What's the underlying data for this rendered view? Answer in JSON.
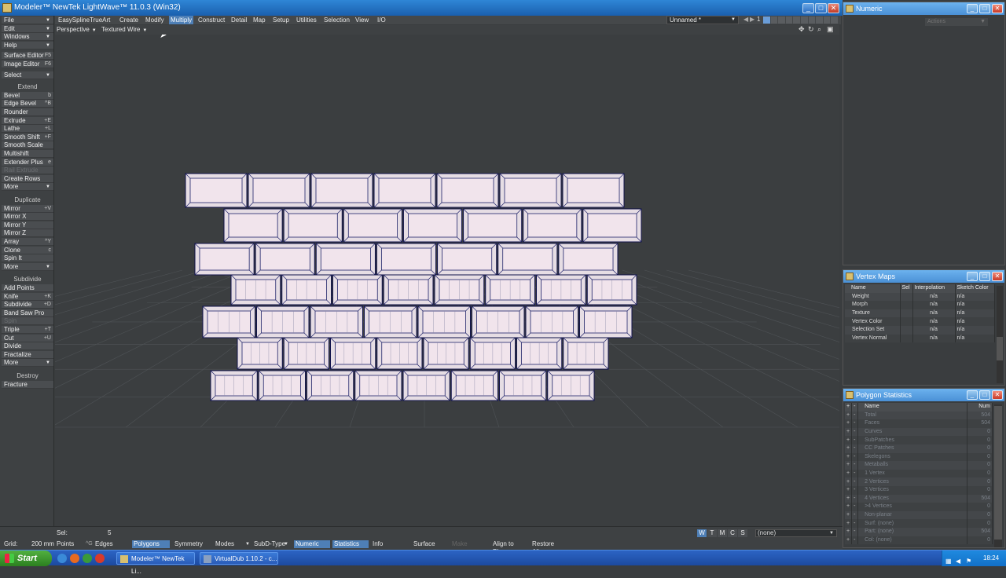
{
  "window": {
    "title": "Modeler™ NewTek LightWave™ 11.0.3 (Win32)"
  },
  "menus": [
    "EasySpline",
    "TrueArt",
    "Create",
    "Modify",
    "Multiply",
    "Construct",
    "Detail",
    "Map",
    "Setup",
    "Utilities",
    "Selection",
    "View",
    "I/O"
  ],
  "active_menu": "Multiply",
  "layer": {
    "object": "Unnamed *",
    "number": "1"
  },
  "viewport": {
    "view": "Perspective",
    "render_mode": "Textured Wire"
  },
  "left_top": [
    {
      "label": "File",
      "sc": "",
      "dd": true
    },
    {
      "label": "Edit",
      "sc": "",
      "dd": true
    },
    {
      "label": "Windows",
      "sc": "",
      "dd": true
    },
    {
      "label": "Help",
      "sc": "",
      "dd": true
    },
    {
      "label": "Surface Editor",
      "sc": "F5",
      "dd": false
    },
    {
      "label": "Image Editor",
      "sc": "F6",
      "dd": false
    },
    {
      "label": "Select",
      "sc": "",
      "dd": true
    }
  ],
  "sections": {
    "extend": {
      "header": "Extend",
      "items": [
        {
          "label": "Bevel",
          "sc": "b"
        },
        {
          "label": "Edge Bevel",
          "sc": "^B"
        },
        {
          "label": "Rounder",
          "sc": ""
        },
        {
          "label": "Extrude",
          "sc": "+E"
        },
        {
          "label": "Lathe",
          "sc": "+L"
        },
        {
          "label": "Smooth Shift",
          "sc": "+F"
        },
        {
          "label": "Smooth Scale",
          "sc": ""
        },
        {
          "label": "Multishift",
          "sc": ""
        },
        {
          "label": "Extender Plus",
          "sc": "e"
        },
        {
          "label": "Rail Extrude",
          "sc": "",
          "dis": true
        },
        {
          "label": "Create Rows",
          "sc": ""
        },
        {
          "label": "More",
          "sc": "",
          "dd": true
        }
      ]
    },
    "duplicate": {
      "header": "Duplicate",
      "items": [
        {
          "label": "Mirror",
          "sc": "+V"
        },
        {
          "label": "Mirror X",
          "sc": ""
        },
        {
          "label": "Mirror Y",
          "sc": ""
        },
        {
          "label": "Mirror Z",
          "sc": ""
        },
        {
          "label": "Array",
          "sc": "^Y"
        },
        {
          "label": "Clone",
          "sc": "c"
        },
        {
          "label": "Spin It",
          "sc": ""
        },
        {
          "label": "More",
          "sc": "",
          "dd": true
        }
      ]
    },
    "subdivide": {
      "header": "Subdivide",
      "items": [
        {
          "label": "Add Points",
          "sc": ""
        },
        {
          "label": "Knife",
          "sc": "+K"
        },
        {
          "label": "Subdivide",
          "sc": "+D"
        },
        {
          "label": "Band Saw Pro",
          "sc": ""
        },
        {
          "label": "Spin",
          "sc": "",
          "dis": true
        },
        {
          "label": "Triple",
          "sc": "+T"
        },
        {
          "label": "Cut",
          "sc": "+U"
        },
        {
          "label": "Divide",
          "sc": ""
        },
        {
          "label": "Fractalize",
          "sc": ""
        },
        {
          "label": "More",
          "sc": "",
          "dd": true
        }
      ]
    },
    "destroy": {
      "header": "Destroy",
      "items": [
        {
          "label": "Fracture",
          "sc": ""
        }
      ]
    }
  },
  "numeric": {
    "title": "Numeric",
    "actions": "Actions"
  },
  "vertex_maps": {
    "title": "Vertex Maps",
    "columns": [
      "Name",
      "Sel",
      "Interpolation",
      "Sketch Color"
    ],
    "rows": [
      {
        "name": "Weight",
        "sel": "",
        "interp": "n/a",
        "sketch": "n/a"
      },
      {
        "name": "Morph",
        "sel": "",
        "interp": "n/a",
        "sketch": "n/a"
      },
      {
        "name": "Texture",
        "sel": "",
        "interp": "n/a",
        "sketch": "n/a"
      },
      {
        "name": "Vertex Color",
        "sel": "",
        "interp": "n/a",
        "sketch": "n/a"
      },
      {
        "name": "Selection Set",
        "sel": "",
        "interp": "n/a",
        "sketch": "n/a"
      },
      {
        "name": "Vertex Normal",
        "sel": "",
        "interp": "n/a",
        "sketch": "n/a"
      }
    ]
  },
  "poly_stats": {
    "title": "Polygon Statistics",
    "columns": [
      "Name",
      "Num"
    ],
    "rows": [
      {
        "name": "Total",
        "num": "504"
      },
      {
        "name": "Faces",
        "num": "504"
      },
      {
        "name": "Curves",
        "num": "0"
      },
      {
        "name": "SubPatches",
        "num": "0"
      },
      {
        "name": "CC Patches",
        "num": "0"
      },
      {
        "name": "Skelegons",
        "num": "0"
      },
      {
        "name": "Metaballs",
        "num": "0"
      },
      {
        "name": "1 Vertex",
        "num": "0"
      },
      {
        "name": "2 Vertices",
        "num": "0"
      },
      {
        "name": "3 Vertices",
        "num": "0"
      },
      {
        "name": "4 Vertices",
        "num": "504"
      },
      {
        "name": ">4 Vertices",
        "num": "0"
      },
      {
        "name": "Non-planar",
        "num": "0"
      },
      {
        "name": "Surf: (none)",
        "num": "0"
      },
      {
        "name": "Part: (none)",
        "num": "504"
      },
      {
        "name": "Col: (none)",
        "num": "0"
      }
    ]
  },
  "status": {
    "sel_label": "Sel:",
    "sel_value": "5",
    "grid_label": "Grid:",
    "grid_value": "200 mm",
    "modes": [
      "Points",
      "Edges",
      "Polygons"
    ],
    "active_mode": "Polygons",
    "symmetry": "Symmetry",
    "modes_btn": "Modes",
    "subd_type": "SubD-Type",
    "numeric": "Numeric",
    "statistics": "Statistics",
    "info": "Info",
    "surface": "Surface",
    "make": "Make",
    "align_plane": "Align to Plane",
    "restore_align": "Restore Align",
    "wtmcs": [
      "W",
      "T",
      "M",
      "C",
      "S"
    ],
    "surface_select": "(none)"
  },
  "taskbar": {
    "start": "Start",
    "tasks": [
      "Modeler™ NewTek Li...",
      "VirtualDub 1.10.2 - c..."
    ],
    "clock": "18:24"
  },
  "colors": {
    "accent": "#4e7fb6",
    "brick": "#e8d8e0",
    "wire": "#0a0a44",
    "title_blue": "#2f86d6"
  }
}
